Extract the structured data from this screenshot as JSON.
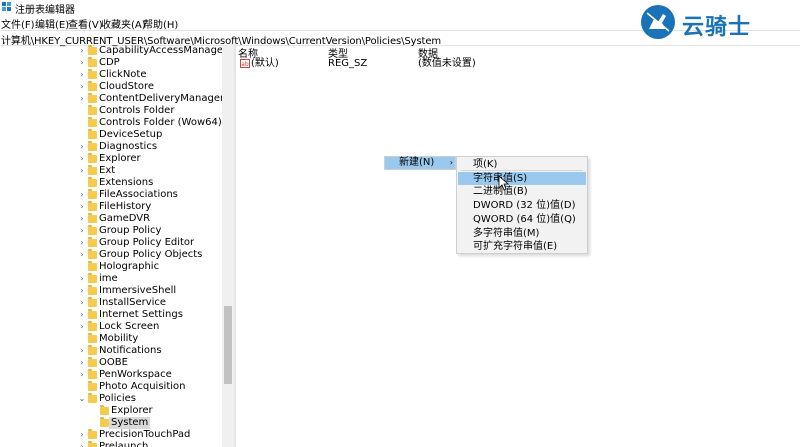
{
  "window": {
    "title": "注册表编辑器"
  },
  "menu": [
    "文件(F)",
    "编辑(E)",
    "查看(V)",
    "收藏夹(A)",
    "帮助(H)"
  ],
  "address": "计算机\\HKEY_CURRENT_USER\\Software\\Microsoft\\Windows\\CurrentVersion\\Policies\\System",
  "logo": {
    "text": "云骑士",
    "color": "#1a73b8"
  },
  "tree": [
    {
      "label": "CapabilityAccessManager",
      "expandable": true
    },
    {
      "label": "CDP",
      "expandable": true
    },
    {
      "label": "ClickNote",
      "expandable": true
    },
    {
      "label": "CloudStore",
      "expandable": true
    },
    {
      "label": "ContentDeliveryManager",
      "expandable": true
    },
    {
      "label": "Controls Folder",
      "expandable": false
    },
    {
      "label": "Controls Folder (Wow64)",
      "expandable": false
    },
    {
      "label": "DeviceSetup",
      "expandable": false
    },
    {
      "label": "Diagnostics",
      "expandable": true
    },
    {
      "label": "Explorer",
      "expandable": true
    },
    {
      "label": "Ext",
      "expandable": true
    },
    {
      "label": "Extensions",
      "expandable": false
    },
    {
      "label": "FileAssociations",
      "expandable": true
    },
    {
      "label": "FileHistory",
      "expandable": true
    },
    {
      "label": "GameDVR",
      "expandable": true
    },
    {
      "label": "Group Policy",
      "expandable": true
    },
    {
      "label": "Group Policy Editor",
      "expandable": true
    },
    {
      "label": "Group Policy Objects",
      "expandable": true
    },
    {
      "label": "Holographic",
      "expandable": false
    },
    {
      "label": "ime",
      "expandable": true
    },
    {
      "label": "ImmersiveShell",
      "expandable": true
    },
    {
      "label": "InstallService",
      "expandable": true
    },
    {
      "label": "Internet Settings",
      "expandable": true
    },
    {
      "label": "Lock Screen",
      "expandable": true
    },
    {
      "label": "Mobility",
      "expandable": false
    },
    {
      "label": "Notifications",
      "expandable": true
    },
    {
      "label": "OOBE",
      "expandable": true
    },
    {
      "label": "PenWorkspace",
      "expandable": true
    },
    {
      "label": "Photo Acquisition",
      "expandable": false
    },
    {
      "label": "Policies",
      "expandable": true,
      "expanded": true
    },
    {
      "label": "Explorer",
      "expandable": false,
      "child": true
    },
    {
      "label": "System",
      "expandable": false,
      "child": true,
      "selected": true
    },
    {
      "label": "PrecisionTouchPad",
      "expandable": true
    },
    {
      "label": "Prelaunch",
      "expandable": true
    }
  ],
  "list": {
    "columns": [
      "名称",
      "类型",
      "数据"
    ],
    "rows": [
      {
        "name": "(默认)",
        "type": "REG_SZ",
        "data": "(数值未设置)",
        "icon": "string-value-icon"
      }
    ]
  },
  "context_menu": {
    "label": "新建(N)"
  },
  "submenu": {
    "items": [
      "项(K)",
      "字符串值(S)",
      "二进制值(B)",
      "DWORD (32 位)值(D)",
      "QWORD (64 位)值(Q)",
      "多字符串值(M)",
      "可扩充字符串值(E)"
    ],
    "highlighted": 1
  }
}
